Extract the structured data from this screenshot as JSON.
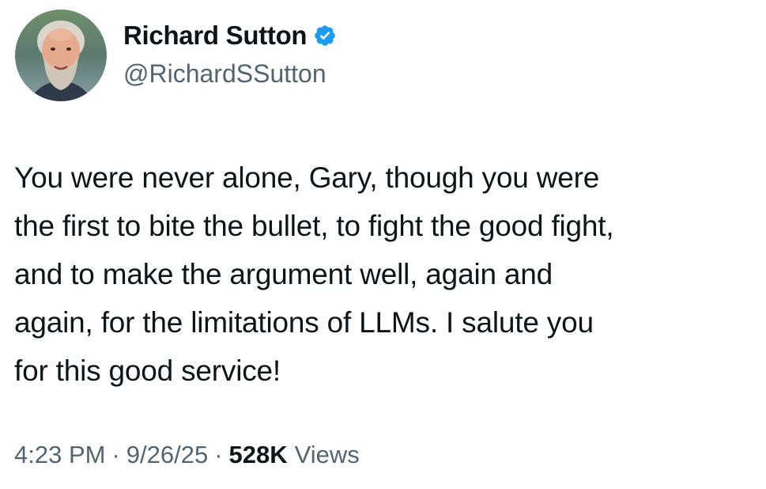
{
  "tweet": {
    "author": {
      "display_name": "Richard Sutton",
      "handle": "@RichardSSutton",
      "avatar": "profile-photo",
      "verified_icon": "verified-badge-icon",
      "verified_color": "#1d9bf0"
    },
    "body_lines": [
      "You were never alone, Gary, though you were",
      "the first to bite the bullet, to fight the good fight,",
      "and to make the argument well, again and",
      "again, for the limitations of LLMs. I salute you",
      "for this good service!"
    ],
    "meta": {
      "time": "4:23 PM",
      "separator": "·",
      "date": "9/26/25",
      "views_count": "528K",
      "views_label": "Views"
    }
  },
  "colors": {
    "text_primary": "#0f1419",
    "text_secondary": "#536471",
    "background": "#ffffff"
  }
}
